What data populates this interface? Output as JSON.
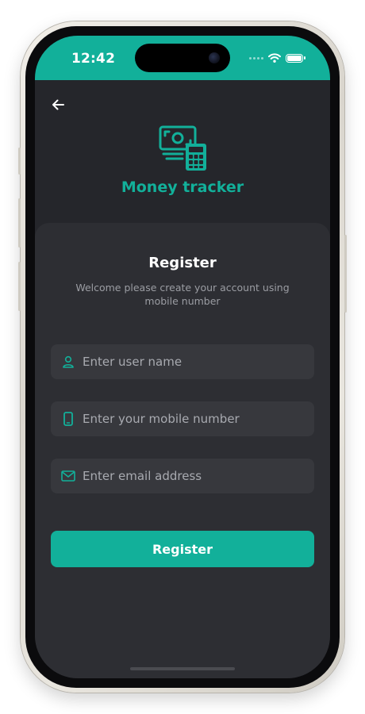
{
  "status": {
    "time": "12:42"
  },
  "app": {
    "title": "Money tracker",
    "accent": "#12b09a",
    "logo_icon": "money-calculator-icon"
  },
  "form": {
    "title": "Register",
    "subtitle": "Welcome please create your account using mobile number",
    "fields": [
      {
        "icon": "user-icon",
        "placeholder": "Enter user name",
        "value": ""
      },
      {
        "icon": "mobile-phone-icon",
        "placeholder": "Enter your mobile number",
        "value": ""
      },
      {
        "icon": "mail-icon",
        "placeholder": "Enter email address",
        "value": ""
      }
    ],
    "submit_label": "Register"
  }
}
